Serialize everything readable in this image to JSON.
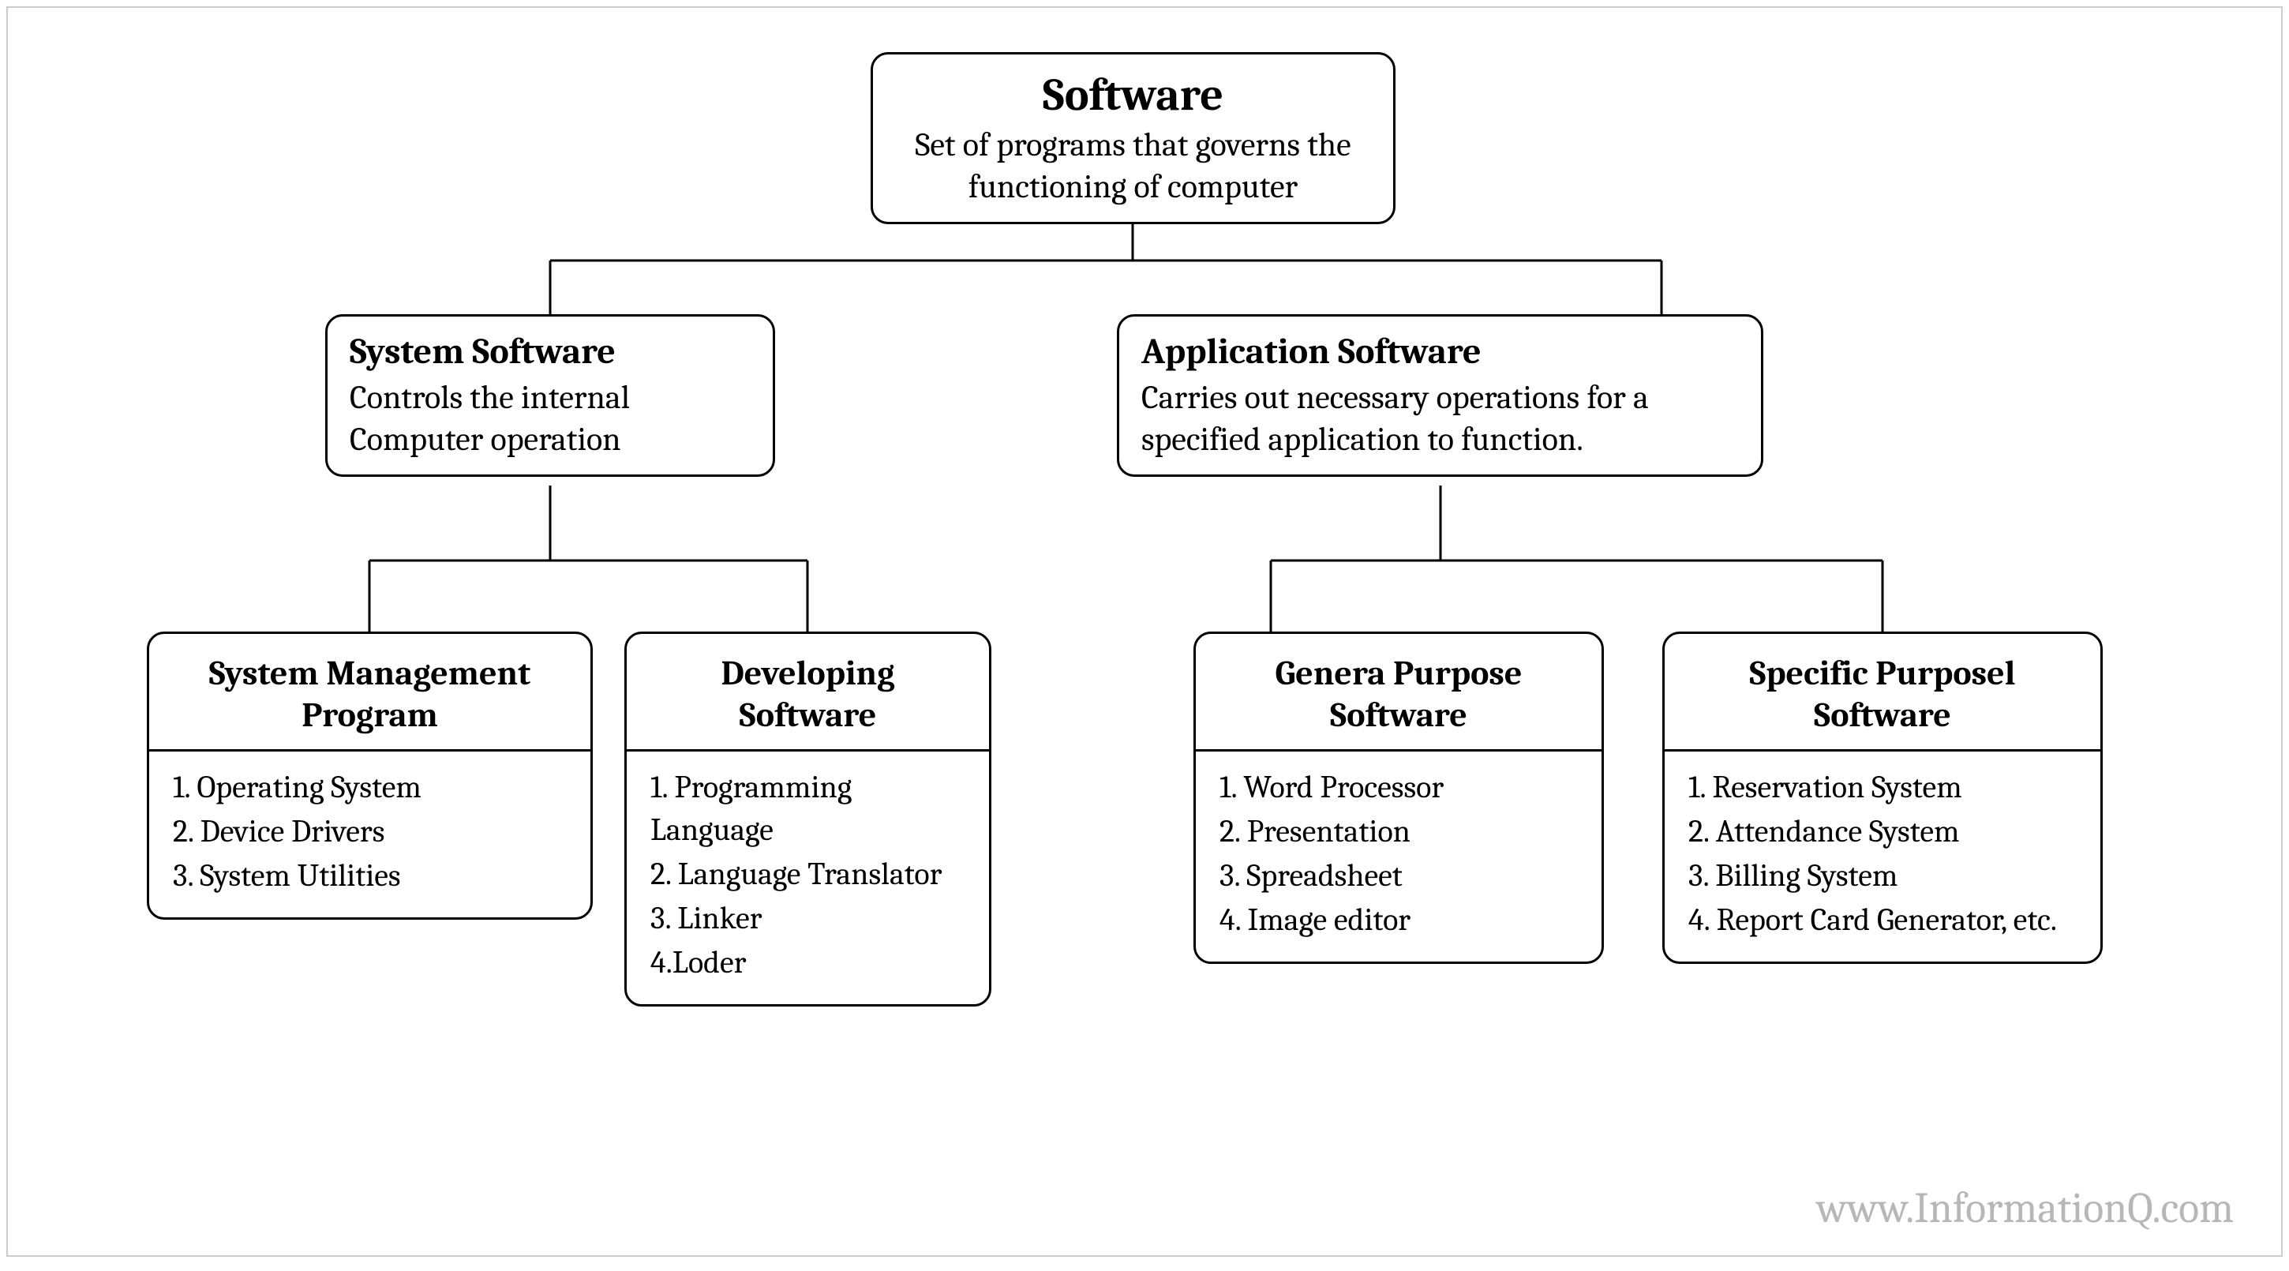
{
  "root": {
    "title": "Software",
    "desc": "Set of programs that governs the  functioning of computer"
  },
  "sys": {
    "title": "System Software",
    "desc": "Controls the internal Computer operation"
  },
  "app": {
    "title": "Application Software",
    "desc": "Carries out necessary operations for a specified application to function."
  },
  "leaf1": {
    "title": "System Management Program",
    "items": [
      "1. Operating System",
      "2. Device Drivers",
      "3. System Utilities"
    ]
  },
  "leaf2": {
    "title": "Developing Software",
    "items": [
      "1. Programming Language",
      "2. Language Translator",
      "3. Linker",
      "4.Loder"
    ]
  },
  "leaf3": {
    "title": "Genera Purpose Software",
    "items": [
      "1. Word Processor",
      "2. Presentation",
      "3. Spreadsheet",
      "4. Image editor"
    ]
  },
  "leaf4": {
    "title": "Specific Purposel Software",
    "items": [
      "1. Reservation System",
      "2. Attendance System",
      "3. Billing System",
      "4. Report Card Generator, etc."
    ]
  },
  "watermark": "www.InformationQ.com"
}
